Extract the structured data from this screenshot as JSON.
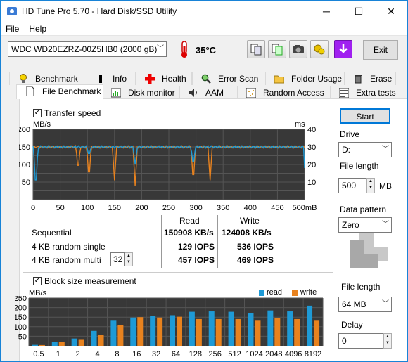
{
  "window": {
    "title": "HD Tune Pro 5.70 - Hard Disk/SSD Utility",
    "minimize": "─",
    "maximize": "☐",
    "close": "✕"
  },
  "menu": {
    "file": "File",
    "help": "Help"
  },
  "toolbar": {
    "drive": "WDC WD20EZRZ-00Z5HB0 (2000 gB)",
    "temperature": "35°C",
    "exit": "Exit",
    "icons": [
      "copy-info-icon",
      "copy-text-icon",
      "screenshot-icon",
      "options-icon",
      "save-icon"
    ]
  },
  "tabs_row1": [
    "Benchmark",
    "Info",
    "Health",
    "Error Scan",
    "Folder Usage",
    "Erase"
  ],
  "tabs_row2": [
    "File Benchmark",
    "Disk monitor",
    "AAM",
    "Random Access",
    "Extra tests"
  ],
  "transfer": {
    "checkbox_label": "Transfer speed",
    "checked": true,
    "left_unit": "MB/s",
    "right_unit": "ms",
    "left_ticks": [
      "200",
      "150",
      "100",
      "50"
    ],
    "right_ticks": [
      "40",
      "30",
      "20",
      "10"
    ],
    "x_ticks": [
      "0",
      "50",
      "100",
      "150",
      "200",
      "250",
      "300",
      "350",
      "400",
      "450",
      "500mB"
    ],
    "read_mbs": 150,
    "write_mbs": 150,
    "dips_write": [
      {
        "x": 83,
        "y": 80
      },
      {
        "x": 103,
        "y": 55
      },
      {
        "x": 150,
        "y": 55
      },
      {
        "x": 188,
        "y": 40
      },
      {
        "x": 295,
        "y": 45
      },
      {
        "x": 326,
        "y": 55
      }
    ],
    "dips_read": [
      {
        "x": 5,
        "y": 25
      },
      {
        "x": 103,
        "y": 125
      },
      {
        "x": 188,
        "y": 100
      },
      {
        "x": 295,
        "y": 95
      },
      {
        "x": 502,
        "y": 30
      }
    ]
  },
  "results": {
    "col_read": "Read",
    "col_write": "Write",
    "rows": [
      {
        "label": "Sequential",
        "read": "150908 KB/s",
        "write": "124008 KB/s"
      },
      {
        "label": "4 KB random single",
        "read": "129 IOPS",
        "write": "536 IOPS"
      },
      {
        "label": "4 KB random multi",
        "read": "457 IOPS",
        "write": "469 IOPS",
        "queue": "32"
      }
    ]
  },
  "block": {
    "checkbox_label": "Block size measurement",
    "checked": true,
    "unit": "MB/s",
    "legend_read": "read",
    "legend_write": "write",
    "y_ticks": [
      "250",
      "200",
      "150",
      "100",
      "50"
    ],
    "categories": [
      "0.5",
      "1",
      "2",
      "4",
      "8",
      "16",
      "32",
      "64",
      "128",
      "256",
      "512",
      "1024",
      "2048",
      "4096",
      "8192"
    ],
    "read": [
      5,
      22,
      38,
      78,
      135,
      148,
      158,
      160,
      178,
      180,
      178,
      172,
      185,
      180,
      210
    ],
    "write": [
      4,
      20,
      35,
      58,
      110,
      150,
      148,
      152,
      140,
      140,
      140,
      135,
      145,
      140,
      135
    ]
  },
  "side": {
    "start": "Start",
    "drive_label": "Drive",
    "drive_value": "D:",
    "file_length_label": "File length",
    "file_length_value": "500",
    "file_length_unit": "MB",
    "pattern_label": "Data pattern",
    "pattern_value": "Zero",
    "file_length2_label": "File length",
    "file_length2_value": "64 MB",
    "delay_label": "Delay",
    "delay_value": "0"
  },
  "colors": {
    "read": "#1e9ad6",
    "write": "#e8821e",
    "graph_bg": "#383838",
    "grid": "#555555"
  }
}
